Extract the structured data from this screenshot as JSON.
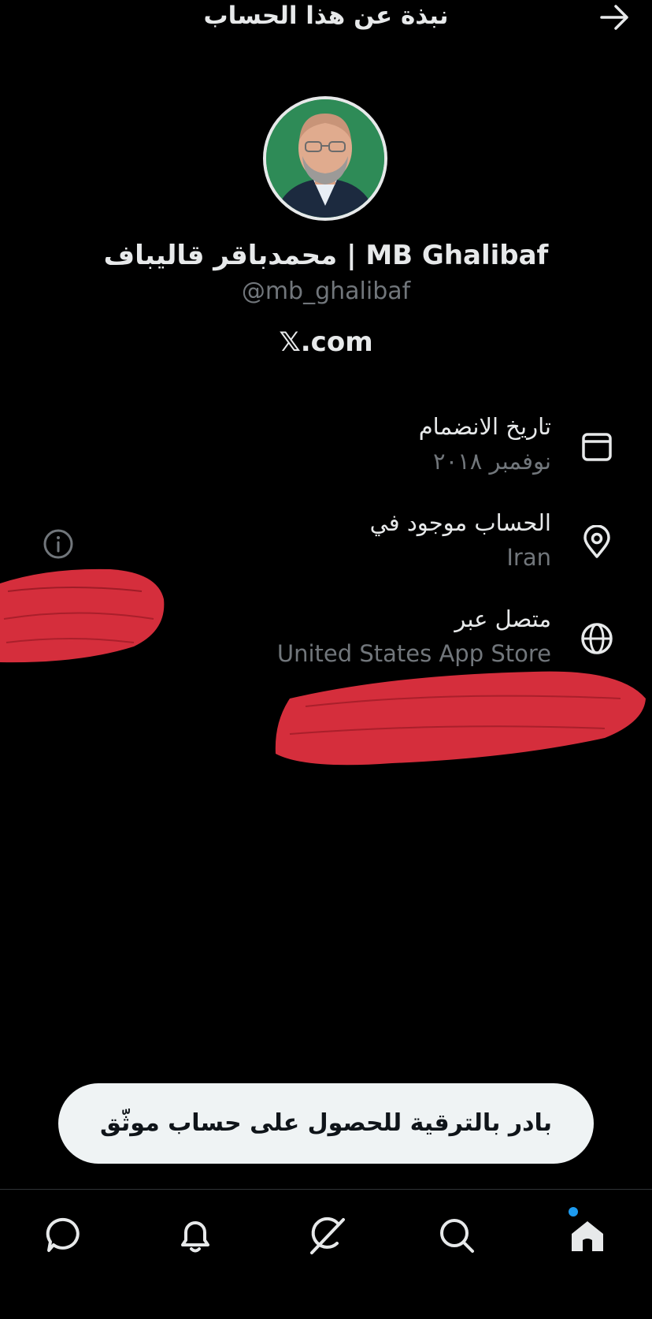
{
  "header": {
    "title": "نبذة عن هذا الحساب"
  },
  "profile": {
    "display_name": "محمدباقر قالیباف | MB Ghalibaf",
    "handle": "@mb_ghalibaf",
    "site": "𝕏.com"
  },
  "details": [
    {
      "icon": "calendar-icon",
      "label": "تاريخ الانضمام",
      "value": "نوفمبر ٢٠١٨"
    },
    {
      "icon": "location-pin-icon",
      "label": "الحساب موجود في",
      "value": "Iran"
    },
    {
      "icon": "globe-icon",
      "label": "متصل عبر",
      "value": "United States App Store"
    }
  ],
  "cta": {
    "label": "بادر بالترقية للحصول على حساب موثّق"
  },
  "tabs": [
    "home-icon",
    "search-icon",
    "grok-icon",
    "notifications-icon",
    "messages-icon"
  ],
  "colors": {
    "background": "#000000",
    "text_primary": "#e7e9ea",
    "text_secondary": "#71767b",
    "accent": "#1d9bf0",
    "redaction": "#e0303f"
  }
}
